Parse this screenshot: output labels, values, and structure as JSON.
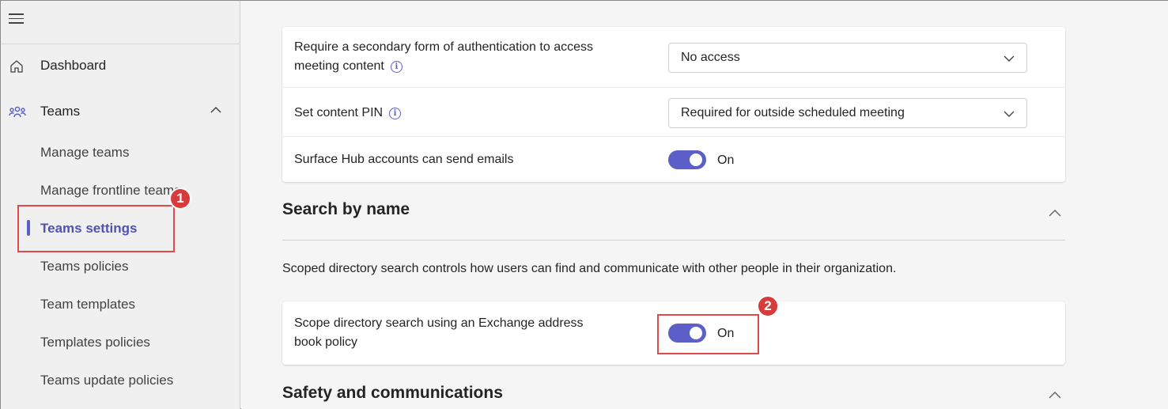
{
  "sidebar": {
    "dashboard_label": "Dashboard",
    "teams_label": "Teams",
    "sub_items": [
      {
        "label": "Manage teams"
      },
      {
        "label": "Manage frontline teams"
      },
      {
        "label": "Teams settings"
      },
      {
        "label": "Teams policies"
      },
      {
        "label": "Team templates"
      },
      {
        "label": "Templates policies"
      },
      {
        "label": "Teams update policies"
      }
    ],
    "active_item": "Teams settings"
  },
  "main": {
    "meeting_card": {
      "rows": [
        {
          "label_line1": "Require a secondary form of authentication to access",
          "label_line2": "meeting content",
          "value": "No access"
        },
        {
          "label": "Set content PIN",
          "value": "Required for outside scheduled meeting"
        },
        {
          "label": "Surface Hub accounts can send emails",
          "toggle_state": "On"
        }
      ]
    },
    "search_section": {
      "title": "Search by name",
      "description": "Scoped directory search controls how users can find and communicate with other people in their organization.",
      "row": {
        "label_line1": "Scope directory search using an Exchange address",
        "label_line2": "book policy",
        "toggle_state": "On"
      }
    },
    "safety_section": {
      "title": "Safety and communications"
    }
  },
  "callouts": [
    "1",
    "2"
  ],
  "colors": {
    "accent": "#5b5fc7",
    "callout": "#e04a4a"
  }
}
